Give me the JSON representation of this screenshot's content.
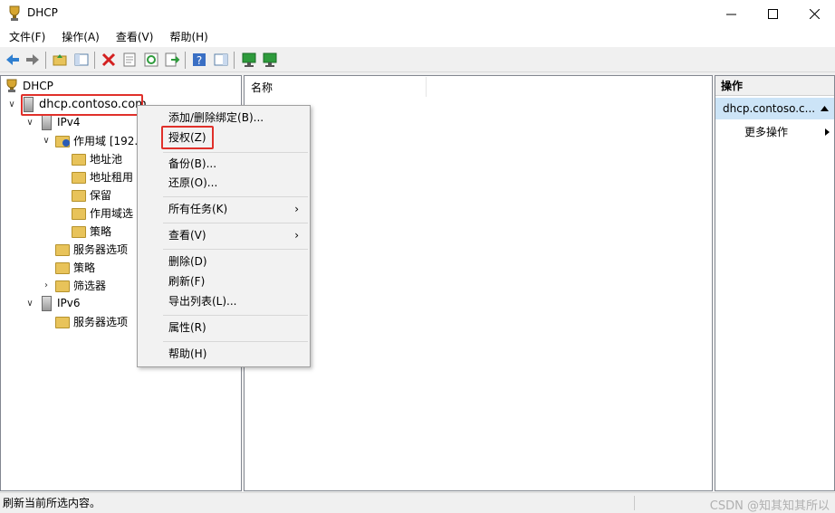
{
  "window": {
    "title": "DHCP"
  },
  "menubar": [
    "文件(F)",
    "操作(A)",
    "查看(V)",
    "帮助(H)"
  ],
  "toolbar": {
    "icons": [
      "back-icon",
      "forward-icon",
      "up-folder-icon",
      "show-hide-tree-icon",
      "delete-icon",
      "properties-icon",
      "refresh-icon",
      "export-list-icon",
      "help-icon",
      "show-hide-action-pane-icon",
      "server-icon",
      "add-server-icon"
    ]
  },
  "tree": {
    "root": "DHCP",
    "server": "dhcp.contoso.com",
    "ipv4": "IPv4",
    "scope": "作用域 [192.",
    "address_pool": "地址池",
    "address_leases": "地址租用",
    "reservations": "保留",
    "scope_options": "作用域选",
    "scope_policies": "策略",
    "server_options": "服务器选项",
    "policies": "策略",
    "filters": "筛选器",
    "ipv6": "IPv6",
    "ipv6_server_options": "服务器选项"
  },
  "content": {
    "column_name": "名称"
  },
  "actions": {
    "title": "操作",
    "target": "dhcp.contoso.c...",
    "more": "更多操作"
  },
  "context_menu": {
    "add_remove_bindings": "添加/删除绑定(B)...",
    "authorize": "授权(Z)",
    "backup": "备份(B)...",
    "restore": "还原(O)...",
    "all_tasks": "所有任务(K)",
    "view": "查看(V)",
    "delete": "删除(D)",
    "refresh": "刷新(F)",
    "export_list": "导出列表(L)...",
    "properties": "属性(R)",
    "help": "帮助(H)"
  },
  "status": {
    "text": "刷新当前所选内容。",
    "watermark": "CSDN @知其知其所以"
  },
  "colors": {
    "highlight_box": "#e0302a",
    "selection": "#cce4f7"
  }
}
